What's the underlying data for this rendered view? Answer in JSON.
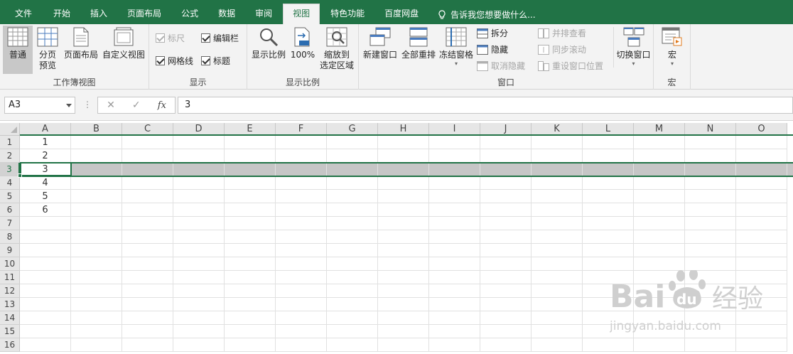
{
  "tabs": [
    {
      "label": "文件"
    },
    {
      "label": "开始"
    },
    {
      "label": "插入"
    },
    {
      "label": "页面布局"
    },
    {
      "label": "公式"
    },
    {
      "label": "数据"
    },
    {
      "label": "审阅"
    },
    {
      "label": "视图"
    },
    {
      "label": "特色功能"
    },
    {
      "label": "百度网盘"
    }
  ],
  "active_tab": "视图",
  "tell_me": "告诉我您想要做什么...",
  "ribbon": {
    "workbook_views": {
      "label": "工作簿视图",
      "normal": "普通",
      "page_break_line1": "分页",
      "page_break_line2": "预览",
      "page_layout": "页面布局",
      "custom_views": "自定义视图"
    },
    "show": {
      "label": "显示",
      "ruler": "标尺",
      "formula_bar": "编辑栏",
      "gridlines": "网格线",
      "headings": "标题"
    },
    "zoom": {
      "label": "显示比例",
      "zoom": "显示比例",
      "zoom100": "100%",
      "zoom_selection_line1": "缩放到",
      "zoom_selection_line2": "选定区域"
    },
    "window": {
      "label": "窗口",
      "new_window": "新建窗口",
      "arrange_all": "全部重排",
      "freeze_panes": "冻结窗格",
      "split": "拆分",
      "hide": "隐藏",
      "unhide": "取消隐藏",
      "side_by_side": "并排查看",
      "sync_scroll": "同步滚动",
      "reset_position": "重设窗口位置",
      "switch_windows": "切换窗口"
    },
    "macros": {
      "label": "宏",
      "macros": "宏"
    }
  },
  "formula_bar": {
    "name_box": "A3",
    "fx": "fx",
    "value": "3"
  },
  "sheet": {
    "columns": [
      "A",
      "B",
      "C",
      "D",
      "E",
      "F",
      "G",
      "H",
      "I",
      "J",
      "K",
      "L",
      "M",
      "N",
      "O"
    ],
    "rows": [
      "1",
      "2",
      "3",
      "4",
      "5",
      "6",
      "7",
      "8",
      "9",
      "10",
      "11",
      "12",
      "13",
      "14",
      "15",
      "16"
    ],
    "col_a_values": [
      "1",
      "2",
      "3",
      "4",
      "5",
      "6"
    ],
    "selected_row": "3",
    "active_cell": "A3"
  },
  "watermark": {
    "brand": "Bai",
    "brand2": "du",
    "suffix": "经验",
    "url": "jingyan.baidu.com"
  }
}
